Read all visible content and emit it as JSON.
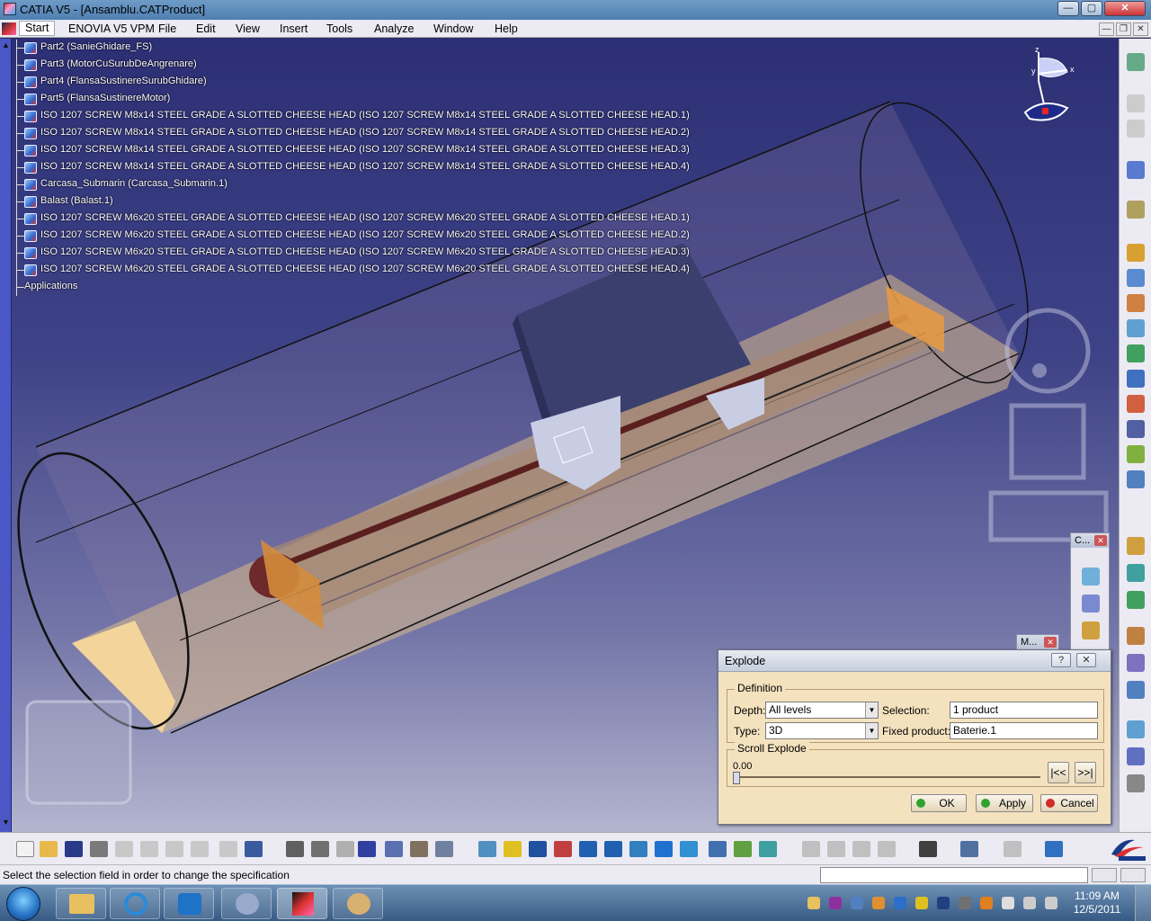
{
  "window": {
    "title": "CATIA V5 - [Ansamblu.CATProduct]",
    "min_label": "—",
    "max_label": "▢",
    "close_label": "✕"
  },
  "menu": {
    "items": [
      "Start",
      "ENOVIA V5 VPM",
      "File",
      "Edit",
      "View",
      "Insert",
      "Tools",
      "Analyze",
      "Window",
      "Help"
    ],
    "mdi_min": "—",
    "mdi_restore": "❐",
    "mdi_close": "✕"
  },
  "tree": {
    "items": [
      "Part2 (SanieGhidare_FS)",
      "Part3 (MotorCuSurubDeAngrenare)",
      "Part4 (FlansaSustinereSurubGhidare)",
      "Part5 (FlansaSustinereMotor)",
      "ISO 1207 SCREW M8x14 STEEL GRADE A SLOTTED CHEESE HEAD (ISO 1207 SCREW M8x14 STEEL GRADE A SLOTTED CHEESE HEAD.1)",
      "ISO 1207 SCREW M8x14 STEEL GRADE A SLOTTED CHEESE HEAD (ISO 1207 SCREW M8x14 STEEL GRADE A SLOTTED CHEESE HEAD.2)",
      "ISO 1207 SCREW M8x14 STEEL GRADE A SLOTTED CHEESE HEAD (ISO 1207 SCREW M8x14 STEEL GRADE A SLOTTED CHEESE HEAD.3)",
      "ISO 1207 SCREW M8x14 STEEL GRADE A SLOTTED CHEESE HEAD (ISO 1207 SCREW M8x14 STEEL GRADE A SLOTTED CHEESE HEAD.4)",
      "Carcasa_Submarin (Carcasa_Submarin.1)",
      "Balast (Balast.1)",
      "ISO 1207 SCREW M6x20 STEEL GRADE A SLOTTED CHEESE HEAD (ISO 1207 SCREW M6x20 STEEL GRADE A SLOTTED CHEESE HEAD.1)",
      "ISO 1207 SCREW M6x20 STEEL GRADE A SLOTTED CHEESE HEAD (ISO 1207 SCREW M6x20 STEEL GRADE A SLOTTED CHEESE HEAD.2)",
      "ISO 1207 SCREW M6x20 STEEL GRADE A SLOTTED CHEESE HEAD (ISO 1207 SCREW M6x20 STEEL GRADE A SLOTTED CHEESE HEAD.3)",
      "ISO 1207 SCREW M6x20 STEEL GRADE A SLOTTED CHEESE HEAD (ISO 1207 SCREW M6x20 STEEL GRADE A SLOTTED CHEESE HEAD.4)"
    ],
    "applications": "Applications"
  },
  "compass": {
    "x_label": "x",
    "y_label": "y",
    "z_label": "z"
  },
  "mini_toolbars": {
    "c_title": "C...",
    "m_title": "M...",
    "close": "✕"
  },
  "explode": {
    "title": "Explode",
    "help": "?",
    "close": "✕",
    "definition_title": "Definition",
    "depth_label": "Depth:",
    "depth_value": "All levels",
    "type_label": "Type:",
    "type_value": "3D",
    "selection_label": "Selection:",
    "selection_value": "1 product",
    "fixed_label": "Fixed product:",
    "fixed_value": "Baterie.1",
    "scroll_title": "Scroll Explode",
    "scroll_value": "0.00",
    "scroll_fraction": 0,
    "first_btn": "|<<",
    "last_btn": ">>|",
    "ok": "OK",
    "apply": "Apply",
    "cancel": "Cancel"
  },
  "statusbar": {
    "message": "Select the selection field in order to change the specification"
  },
  "taskbar": {
    "time": "11:09 AM",
    "date": "12/5/2011"
  },
  "colors": {
    "viewport_top": "#2c2f74",
    "viewport_bottom": "#b4b5cf",
    "dialog_bg": "#f4e2bf",
    "ok_dot": "#2ea32e",
    "apply_dot": "#2ea32e",
    "cancel_dot": "#d42a2a"
  }
}
